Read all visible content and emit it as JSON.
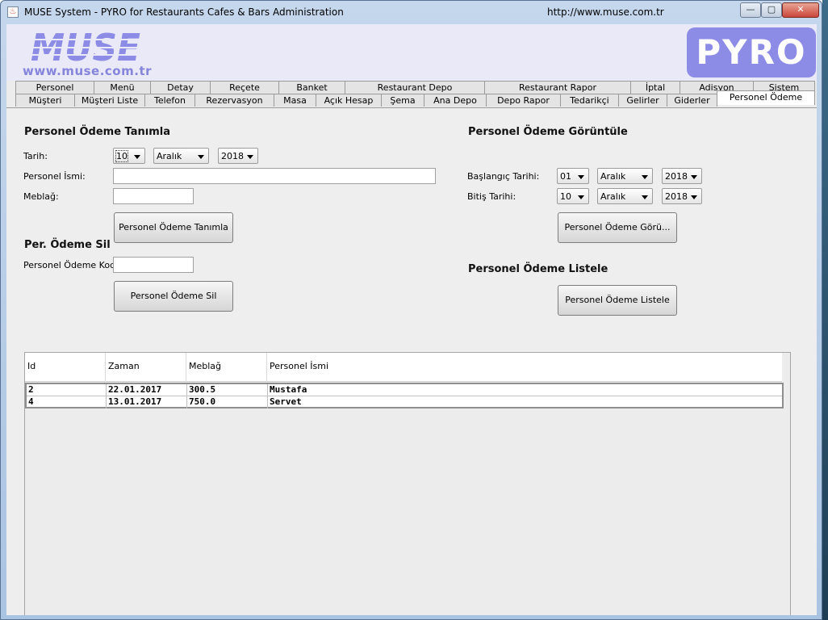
{
  "window": {
    "title": "MUSE System - PYRO for Restaurants Cafes & Bars Administration",
    "url": "http://www.muse.com.tr",
    "minimize": "—",
    "maximize": "▢",
    "close": "✕"
  },
  "header": {
    "logo_left": "MUSE",
    "logo_url": "www.muse.com.tr",
    "logo_right": "PYRO"
  },
  "tabs_row1": [
    "Personel",
    "Menü",
    "Detay",
    "Reçete",
    "Banket",
    "Restaurant Depo",
    "Restaurant Rapor",
    "İptal",
    "Adisyon",
    "Sistem"
  ],
  "tabs_row2": [
    "Müşteri",
    "Müşteri Liste",
    "Telefon",
    "Rezervasyon",
    "Masa",
    "Açık Hesap",
    "Şema",
    "Ana Depo",
    "Depo Rapor",
    "Tedarikçi",
    "Gelirler",
    "Giderler",
    "Personel Ödeme"
  ],
  "define": {
    "title": "Personel Ödeme Tanımla",
    "date_label": "Tarih:",
    "day": "10",
    "month": "Aralık",
    "year": "2018",
    "name_label": "Personel İsmi:",
    "name_value": "",
    "amount_label": "Meblağ:",
    "amount_value": "",
    "button": "Personel Ödeme Tanımla"
  },
  "delete": {
    "title": "Per. Ödeme Sil",
    "code_label": "Personel Ödeme Kodu:",
    "code_value": "",
    "button": "Personel Ödeme Sil"
  },
  "view": {
    "title": "Personel Ödeme Görüntüle",
    "start_label": "Başlangıç Tarihi:",
    "start_day": "01",
    "start_month": "Aralık",
    "start_year": "2018",
    "end_label": "Bitiş Tarihi:",
    "end_day": "10",
    "end_month": "Aralık",
    "end_year": "2018",
    "button": "Personel Ödeme Görü..."
  },
  "list": {
    "title": "Personel Ödeme Listele",
    "button": "Personel Ödeme Listele"
  },
  "table": {
    "columns": [
      "Id",
      "Zaman",
      "Meblağ",
      "Personel İsmi"
    ],
    "rows": [
      [
        "2",
        "22.01.2017",
        "300.5",
        "Mustafa"
      ],
      [
        "4",
        "13.01.2017",
        "750.0",
        "Servet"
      ]
    ]
  }
}
